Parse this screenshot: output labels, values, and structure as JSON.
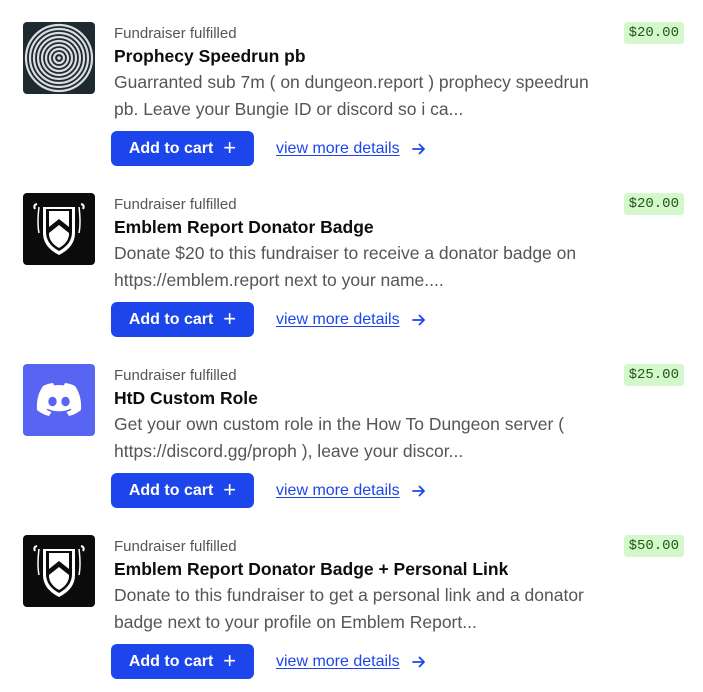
{
  "items": [
    {
      "status": "Fundraiser fulfilled",
      "title": "Prophecy Speedrun pb",
      "description": "Guarranted sub 7m ( on dungeon.report ) prophecy speedrun pb. Leave your Bungie ID or discord so i ca...",
      "price": "$20.00",
      "cart_label": "Add to cart",
      "details_label": "view more details",
      "image": "prophecy-spiral-icon"
    },
    {
      "status": "Fundraiser fulfilled",
      "title": "Emblem Report Donator Badge",
      "description": "Donate $20 to this fundraiser to receive a donator badge on https://emblem.report next to your name....",
      "price": "$20.00",
      "cart_label": "Add to cart",
      "details_label": "view more details",
      "image": "emblem-report-shield-icon"
    },
    {
      "status": "Fundraiser fulfilled",
      "title": "HtD Custom Role",
      "description": "Get your own custom role in the How To Dungeon server ( https://discord.gg/proph ), leave your discor...",
      "price": "$25.00",
      "cart_label": "Add to cart",
      "details_label": "view more details",
      "image": "discord-icon"
    },
    {
      "status": "Fundraiser fulfilled",
      "title": "Emblem Report Donator Badge + Personal Link",
      "description": "Donate to this fundraiser to get a personal link and a donator badge next to your profile on Emblem Report...",
      "price": "$50.00",
      "cart_label": "Add to cart",
      "details_label": "view more details",
      "image": "emblem-report-shield-icon"
    }
  ],
  "colors": {
    "button": "#1c46ec",
    "link": "#1c46ec",
    "price_bg": "#d4f7cc",
    "price_text": "#1d5a12",
    "discord": "#5865f2"
  }
}
